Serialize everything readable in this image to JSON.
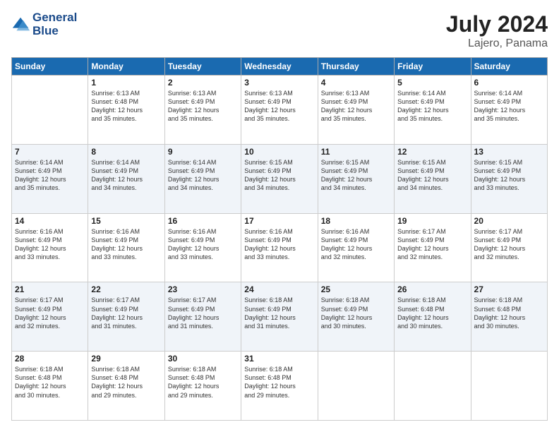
{
  "header": {
    "logo_line1": "General",
    "logo_line2": "Blue",
    "title": "July 2024",
    "location": "Lajero, Panama"
  },
  "days_of_week": [
    "Sunday",
    "Monday",
    "Tuesday",
    "Wednesday",
    "Thursday",
    "Friday",
    "Saturday"
  ],
  "weeks": [
    [
      {
        "day": "",
        "info": ""
      },
      {
        "day": "1",
        "info": "Sunrise: 6:13 AM\nSunset: 6:48 PM\nDaylight: 12 hours\nand 35 minutes."
      },
      {
        "day": "2",
        "info": "Sunrise: 6:13 AM\nSunset: 6:49 PM\nDaylight: 12 hours\nand 35 minutes."
      },
      {
        "day": "3",
        "info": "Sunrise: 6:13 AM\nSunset: 6:49 PM\nDaylight: 12 hours\nand 35 minutes."
      },
      {
        "day": "4",
        "info": "Sunrise: 6:13 AM\nSunset: 6:49 PM\nDaylight: 12 hours\nand 35 minutes."
      },
      {
        "day": "5",
        "info": "Sunrise: 6:14 AM\nSunset: 6:49 PM\nDaylight: 12 hours\nand 35 minutes."
      },
      {
        "day": "6",
        "info": "Sunrise: 6:14 AM\nSunset: 6:49 PM\nDaylight: 12 hours\nand 35 minutes."
      }
    ],
    [
      {
        "day": "7",
        "info": "Sunrise: 6:14 AM\nSunset: 6:49 PM\nDaylight: 12 hours\nand 35 minutes."
      },
      {
        "day": "8",
        "info": "Sunrise: 6:14 AM\nSunset: 6:49 PM\nDaylight: 12 hours\nand 34 minutes."
      },
      {
        "day": "9",
        "info": "Sunrise: 6:14 AM\nSunset: 6:49 PM\nDaylight: 12 hours\nand 34 minutes."
      },
      {
        "day": "10",
        "info": "Sunrise: 6:15 AM\nSunset: 6:49 PM\nDaylight: 12 hours\nand 34 minutes."
      },
      {
        "day": "11",
        "info": "Sunrise: 6:15 AM\nSunset: 6:49 PM\nDaylight: 12 hours\nand 34 minutes."
      },
      {
        "day": "12",
        "info": "Sunrise: 6:15 AM\nSunset: 6:49 PM\nDaylight: 12 hours\nand 34 minutes."
      },
      {
        "day": "13",
        "info": "Sunrise: 6:15 AM\nSunset: 6:49 PM\nDaylight: 12 hours\nand 33 minutes."
      }
    ],
    [
      {
        "day": "14",
        "info": "Sunrise: 6:16 AM\nSunset: 6:49 PM\nDaylight: 12 hours\nand 33 minutes."
      },
      {
        "day": "15",
        "info": "Sunrise: 6:16 AM\nSunset: 6:49 PM\nDaylight: 12 hours\nand 33 minutes."
      },
      {
        "day": "16",
        "info": "Sunrise: 6:16 AM\nSunset: 6:49 PM\nDaylight: 12 hours\nand 33 minutes."
      },
      {
        "day": "17",
        "info": "Sunrise: 6:16 AM\nSunset: 6:49 PM\nDaylight: 12 hours\nand 33 minutes."
      },
      {
        "day": "18",
        "info": "Sunrise: 6:16 AM\nSunset: 6:49 PM\nDaylight: 12 hours\nand 32 minutes."
      },
      {
        "day": "19",
        "info": "Sunrise: 6:17 AM\nSunset: 6:49 PM\nDaylight: 12 hours\nand 32 minutes."
      },
      {
        "day": "20",
        "info": "Sunrise: 6:17 AM\nSunset: 6:49 PM\nDaylight: 12 hours\nand 32 minutes."
      }
    ],
    [
      {
        "day": "21",
        "info": "Sunrise: 6:17 AM\nSunset: 6:49 PM\nDaylight: 12 hours\nand 32 minutes."
      },
      {
        "day": "22",
        "info": "Sunrise: 6:17 AM\nSunset: 6:49 PM\nDaylight: 12 hours\nand 31 minutes."
      },
      {
        "day": "23",
        "info": "Sunrise: 6:17 AM\nSunset: 6:49 PM\nDaylight: 12 hours\nand 31 minutes."
      },
      {
        "day": "24",
        "info": "Sunrise: 6:18 AM\nSunset: 6:49 PM\nDaylight: 12 hours\nand 31 minutes."
      },
      {
        "day": "25",
        "info": "Sunrise: 6:18 AM\nSunset: 6:49 PM\nDaylight: 12 hours\nand 30 minutes."
      },
      {
        "day": "26",
        "info": "Sunrise: 6:18 AM\nSunset: 6:48 PM\nDaylight: 12 hours\nand 30 minutes."
      },
      {
        "day": "27",
        "info": "Sunrise: 6:18 AM\nSunset: 6:48 PM\nDaylight: 12 hours\nand 30 minutes."
      }
    ],
    [
      {
        "day": "28",
        "info": "Sunrise: 6:18 AM\nSunset: 6:48 PM\nDaylight: 12 hours\nand 30 minutes."
      },
      {
        "day": "29",
        "info": "Sunrise: 6:18 AM\nSunset: 6:48 PM\nDaylight: 12 hours\nand 29 minutes."
      },
      {
        "day": "30",
        "info": "Sunrise: 6:18 AM\nSunset: 6:48 PM\nDaylight: 12 hours\nand 29 minutes."
      },
      {
        "day": "31",
        "info": "Sunrise: 6:18 AM\nSunset: 6:48 PM\nDaylight: 12 hours\nand 29 minutes."
      },
      {
        "day": "",
        "info": ""
      },
      {
        "day": "",
        "info": ""
      },
      {
        "day": "",
        "info": ""
      }
    ]
  ],
  "colors": {
    "header_bg": "#1a6ab0",
    "header_text": "#ffffff",
    "title_color": "#222222",
    "location_color": "#555555",
    "logo_color": "#1a4a8a"
  }
}
